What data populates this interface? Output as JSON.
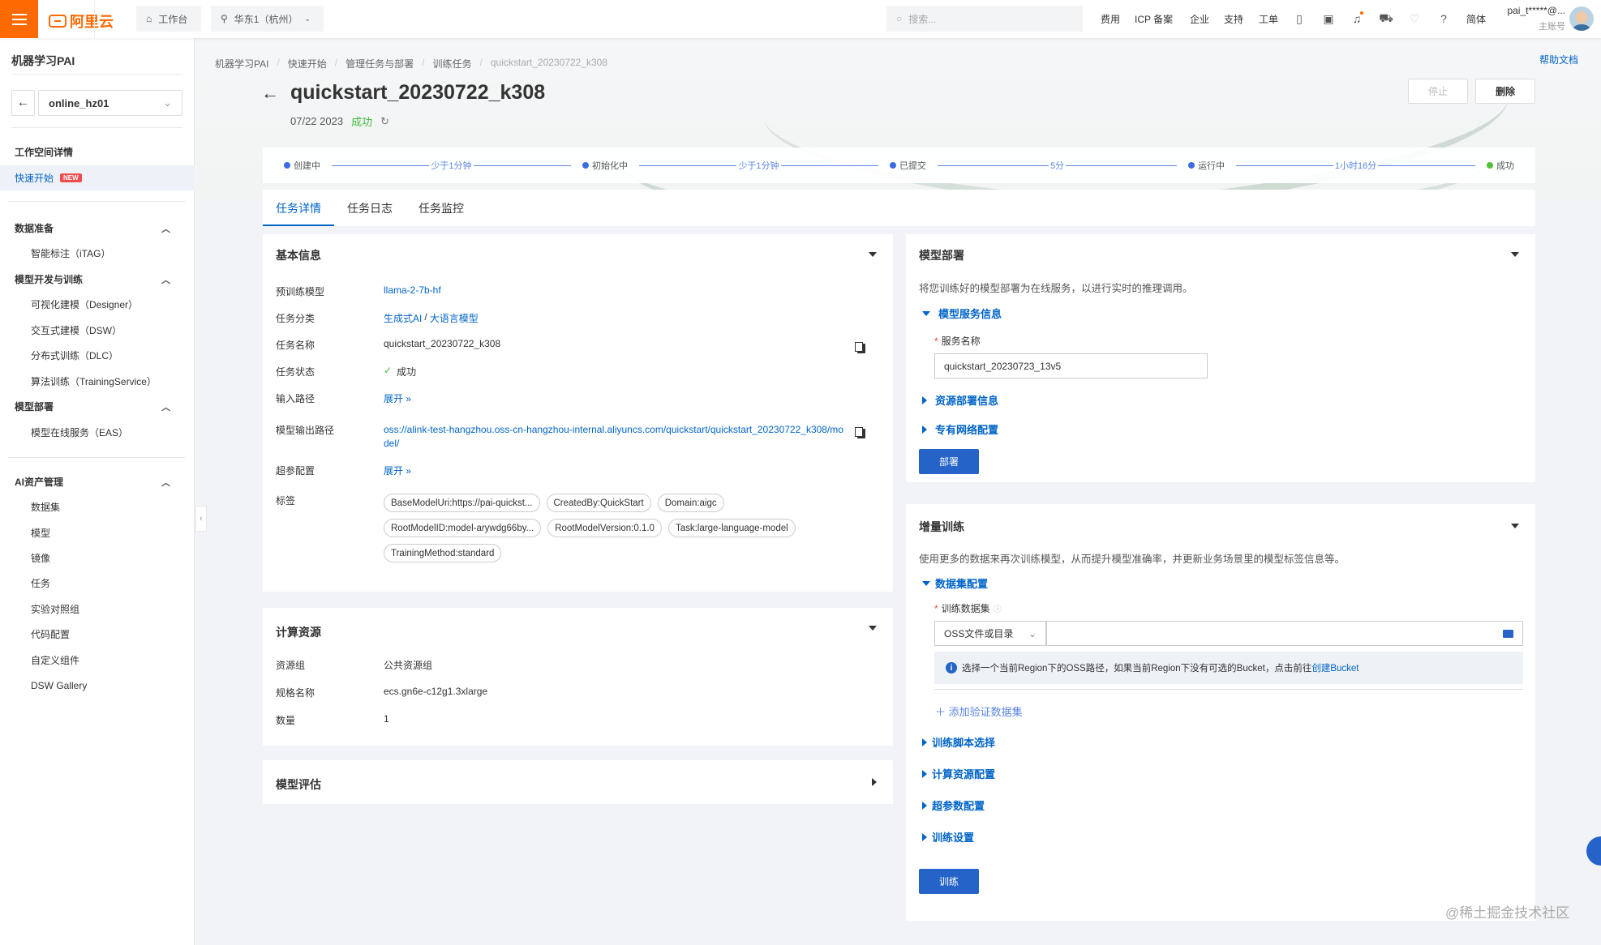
{
  "topbar": {
    "logo": "阿里云",
    "workbench": "工作台",
    "region": "华东1（杭州）",
    "search_placeholder": "搜索...",
    "nav": [
      "费用",
      "ICP 备案",
      "企业",
      "支持",
      "工单"
    ],
    "icons": [
      "app-icon",
      "terminal-icon",
      "bell-icon",
      "cart-icon",
      "bulb-icon",
      "help-icon"
    ],
    "language": "简体",
    "user_name": "pai_t*****@...",
    "user_role": "主账号"
  },
  "sidebar": {
    "title": "机器学习PAI",
    "workspace": "online_hz01",
    "workspace_detail": "工作空间详情",
    "quickstart": "快速开始",
    "new_badge": "NEW",
    "groups": [
      {
        "label": "数据准备",
        "items": [
          "智能标注（iTAG）"
        ]
      },
      {
        "label": "模型开发与训练",
        "items": [
          "可视化建模（Designer）",
          "交互式建模（DSW）",
          "分布式训练（DLC）",
          "算法训练（TrainingService）"
        ]
      },
      {
        "label": "模型部署",
        "items": [
          "模型在线服务（EAS）"
        ]
      },
      {
        "label": "AI资产管理",
        "items": [
          "数据集",
          "模型",
          "镜像",
          "任务",
          "实验对照组",
          "代码配置",
          "自定义组件",
          "DSW Gallery"
        ]
      }
    ]
  },
  "header": {
    "breadcrumb": [
      "机器学习PAI",
      "快速开始",
      "管理任务与部署",
      "训练任务",
      "quickstart_20230722_k308"
    ],
    "help": "帮助文档",
    "title": "quickstart_20230722_k308",
    "date": "07/22 2023",
    "status": "成功",
    "stop_label": "停止",
    "delete_label": "删除"
  },
  "steps": [
    {
      "label": "创建中",
      "duration": "少于1分钟"
    },
    {
      "label": "初始化中",
      "duration": "少于1分钟"
    },
    {
      "label": "已提交",
      "duration": "5分"
    },
    {
      "label": "运行中",
      "duration": "1小时16分"
    },
    {
      "label": "成功",
      "duration": null
    }
  ],
  "tabs": [
    "任务详情",
    "任务日志",
    "任务监控"
  ],
  "basic_info": {
    "title": "基本信息",
    "pretrained_label": "预训练模型",
    "pretrained": "llama-2-7b-hf",
    "category_label": "任务分类",
    "category_a": "生成式AI",
    "category_sep": "/",
    "category_b": "大语言模型",
    "name_label": "任务名称",
    "name": "quickstart_20230722_k308",
    "status_label": "任务状态",
    "status": "成功",
    "input_label": "输入路径",
    "expand": "展开",
    "output_label": "模型输出路径",
    "output": "oss://alink-test-hangzhou.oss-cn-hangzhou-internal.aliyuncs.com/quickstart/quickstart_20230722_k308/model/",
    "hyper_label": "超参配置",
    "tags_label": "标签",
    "tags": [
      "BaseModelUri:https://pai-quickst...",
      "CreatedBy:QuickStart",
      "Domain:aigc",
      "RootModelID:model-arywdg66by...",
      "RootModelVersion:0.1.0",
      "Task:large-language-model",
      "TrainingMethod:standard"
    ]
  },
  "compute": {
    "title": "计算资源",
    "group_label": "资源组",
    "group": "公共资源组",
    "spec_label": "规格名称",
    "spec": "ecs.gn6e-c12g1.3xlarge",
    "count_label": "数量",
    "count": "1"
  },
  "evaluation": {
    "title": "模型评估"
  },
  "deploy": {
    "title": "模型部署",
    "desc": "将您训练好的模型部署为在线服务，以进行实时的推理调用。",
    "service_section": "模型服务信息",
    "service_name_label": "服务名称",
    "service_name": "quickstart_20230723_13v5",
    "resource_section": "资源部署信息",
    "vpc_section": "专有网络配置",
    "deploy_button": "部署"
  },
  "incremental": {
    "title": "增量训练",
    "desc": "使用更多的数据来再次训练模型，从而提升模型准确率，并更新业务场景里的模型标签信息等。",
    "dataset_section": "数据集配置",
    "dataset_label": "训练数据集",
    "source_select": "OSS文件或目录",
    "path_value": "",
    "info_text": "选择一个当前Region下的OSS路径，如果当前Region下没有可选的Bucket，点击前往",
    "info_link": "创建Bucket",
    "add_validation": "添加验证数据集",
    "sections": [
      "训练脚本选择",
      "计算资源配置",
      "超参数配置",
      "训练设置"
    ],
    "train_button": "训练"
  },
  "watermark": "@稀土掘金技术社区"
}
